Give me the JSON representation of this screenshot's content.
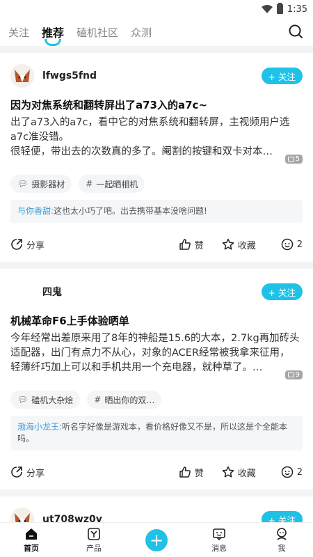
{
  "status": {
    "time": "1:35"
  },
  "top_tabs": [
    "关注",
    "推荐",
    "磕机社区",
    "众测"
  ],
  "posts": [
    {
      "username": "lfwgs5fnd",
      "follow_label": "+ 关注",
      "title": "因为对焦系统和翻转屏出了a73入的a7c~",
      "body_lines": [
        "出了a73入的a7c，看中它的对焦系统和翻转屏，主视频用户选a7c准没错。",
        "很轻便，带出去的次数真的多了。阉割的按键和双卡对本人倒…"
      ],
      "image_count": "5",
      "tags": [
        {
          "icon": "chat-bubble-icon",
          "label": "摄影器材"
        },
        {
          "icon": "hash-icon",
          "label": "一起晒相机"
        }
      ],
      "comment": {
        "who": "与你香甜:",
        "text": "这也太小巧了吧。出去携带基本没啥问题!"
      },
      "actions": {
        "share": "分享",
        "like": "赞",
        "fav": "收藏",
        "comments": "2"
      }
    },
    {
      "username": "四鬼",
      "follow_label": "+ 关注",
      "title": "机械革命F6上手体验晒单",
      "body_lines": [
        "今年经常出差原来用了8年的神船是15.6的大本，2.7kg再加砖头适配器，出门有点力不从心，对象的ACER经常被我拿来征用，轻薄纤巧加上可以和手机共用一个充电器，就种草了。…"
      ],
      "image_count": "9",
      "tags": [
        {
          "icon": "chat-bubble-icon",
          "label": "磕机大杂烩"
        },
        {
          "icon": "hash-icon",
          "label": "晒出你的双…"
        }
      ],
      "comment": {
        "who": "渤海小龙王:",
        "text": "听名字好像是游戏本，看价格好像又不是，所以这是个全能本吗。"
      },
      "actions": {
        "share": "分享",
        "like": "赞",
        "fav": "收藏",
        "comments": "2"
      }
    },
    {
      "username": "ut708wz0v",
      "follow_label": "+ 关注"
    }
  ],
  "bottom_nav": [
    {
      "icon": "home-icon",
      "label": "首页"
    },
    {
      "icon": "product-icon",
      "label": "产品"
    },
    {
      "icon": "plus-icon",
      "label": "+"
    },
    {
      "icon": "message-icon",
      "label": "消息"
    },
    {
      "icon": "profile-icon",
      "label": "我"
    }
  ],
  "colors": {
    "accent": "#1fc2e6",
    "comment_author": "#3a9bd8"
  }
}
